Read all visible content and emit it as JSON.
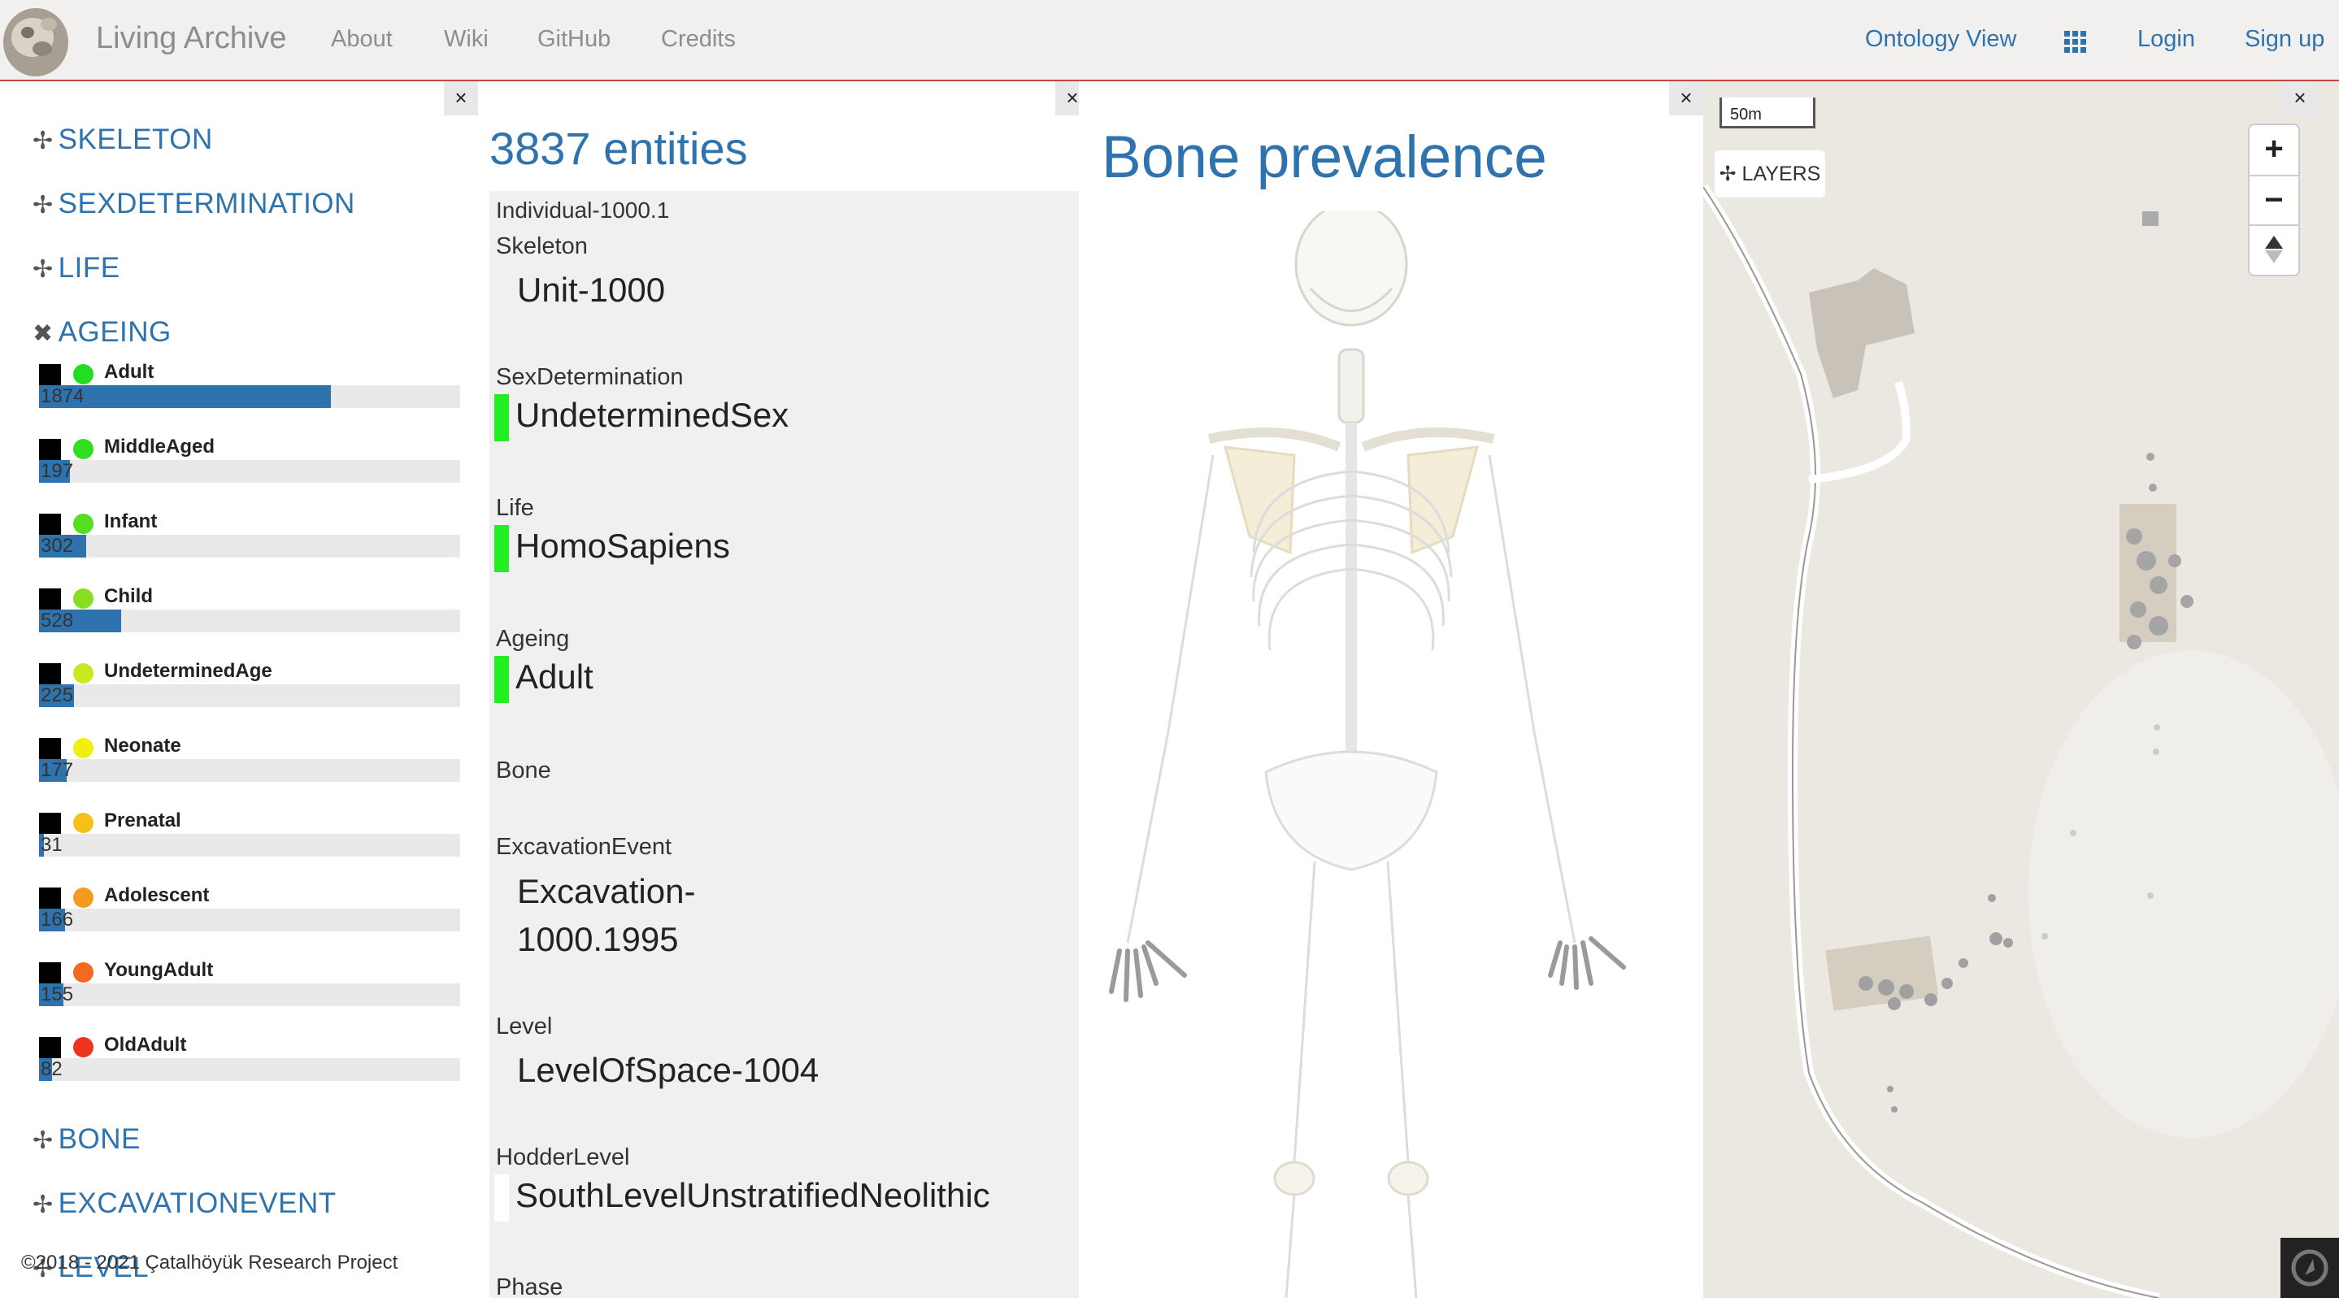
{
  "navbar": {
    "brand": "Living Archive",
    "links": [
      "About",
      "Wiki",
      "GitHub",
      "Credits"
    ],
    "right": {
      "ontology": "Ontology View",
      "login": "Login",
      "signup": "Sign up"
    }
  },
  "close_label": "×",
  "facets": {
    "skeleton": {
      "symbol": "✢",
      "label": "SKELETON"
    },
    "sexdetermination": {
      "symbol": "✢",
      "label": "SEXDETERMINATION"
    },
    "life": {
      "symbol": "✢",
      "label": "LIFE"
    },
    "ageing": {
      "symbol": "✖",
      "label": "AGEING"
    },
    "bone": {
      "symbol": "✢",
      "label": "BONE"
    },
    "excavationevent": {
      "symbol": "✢",
      "label": "EXCAVATIONEVENT"
    },
    "level": {
      "symbol": "✢",
      "label": "LEVEL"
    }
  },
  "ageing_items": [
    {
      "label": "Adult",
      "count": "1874",
      "value": 1874,
      "color": "#22dd22"
    },
    {
      "label": "MiddleAged",
      "count": "197",
      "value": 197,
      "color": "#33dd22"
    },
    {
      "label": "Infant",
      "count": "302",
      "value": 302,
      "color": "#55dd22"
    },
    {
      "label": "Child",
      "count": "528",
      "value": 528,
      "color": "#88dd22"
    },
    {
      "label": "UndeterminedAge",
      "count": "225",
      "value": 225,
      "color": "#c8e822"
    },
    {
      "label": "Neonate",
      "count": "177",
      "value": 177,
      "color": "#f2ee10"
    },
    {
      "label": "Prenatal",
      "count": "31",
      "value": 31,
      "color": "#f6c018"
    },
    {
      "label": "Adolescent",
      "count": "166",
      "value": 166,
      "color": "#f59a20"
    },
    {
      "label": "YoungAdult",
      "count": "155",
      "value": 155,
      "color": "#f26a22"
    },
    {
      "label": "OldAdult",
      "count": "82",
      "value": 82,
      "color": "#ee3320"
    }
  ],
  "ageing_scale_max": 3837,
  "footer": "©2018 - 2021 Çatalhöyük Research Project",
  "entities": {
    "title": "3837 entities",
    "id": "Individual-1000.1",
    "fields": {
      "skeleton": {
        "name": "Skeleton",
        "value": "Unit-1000"
      },
      "sexdetermination": {
        "name": "SexDetermination",
        "value": "UndeterminedSex",
        "marker": "#22ee22"
      },
      "life": {
        "name": "Life",
        "value": "HomoSapiens",
        "marker": "#22ee22"
      },
      "ageing": {
        "name": "Ageing",
        "value": "Adult",
        "marker": "#22ee22"
      },
      "bone": {
        "name": "Bone"
      },
      "excavationevent": {
        "name": "ExcavationEvent",
        "value1": "Excavation-",
        "value2": "1000.1995"
      },
      "level": {
        "name": "Level",
        "value": "LevelOfSpace-1004"
      },
      "hodderlevel": {
        "name": "HodderLevel",
        "value": "SouthLevelUnstratifiedNeolithic",
        "marker": "#ffffff"
      },
      "phase": {
        "name": "Phase"
      }
    }
  },
  "bone": {
    "title": "Bone prevalence"
  },
  "map": {
    "scale": "50m",
    "layers": "LAYERS",
    "zoom_in": "+",
    "zoom_out": "−"
  },
  "colors": {
    "accent": "#2e73ad",
    "nav_border": "#c9453b"
  }
}
